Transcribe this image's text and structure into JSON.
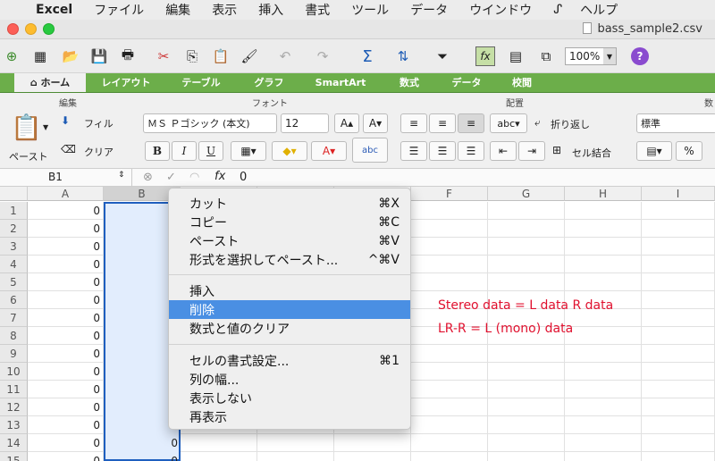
{
  "menubar": {
    "app_name": "Excel",
    "items": [
      "ファイル",
      "編集",
      "表示",
      "挿入",
      "書式",
      "ツール",
      "データ",
      "ウインドウ",
      "ヘルプ"
    ]
  },
  "window": {
    "title": "bass_sample2.csv",
    "zoom": "100%",
    "help": "?"
  },
  "tabs": [
    "ホーム",
    "レイアウト",
    "テーブル",
    "グラフ",
    "SmartArt",
    "数式",
    "データ",
    "校閲"
  ],
  "ribbon": {
    "groups": {
      "edit": "編集",
      "font": "フォント",
      "alignment": "配置",
      "number": "数"
    },
    "paste_label": "ペースト",
    "fill_label": "フィル",
    "clear_label": "クリア",
    "font_name": "ＭＳ Ｐゴシック (本文)",
    "font_size": "12",
    "bold": "B",
    "italic": "I",
    "underline": "U",
    "wrap_label": "折り返し",
    "merge_label": "セル結合",
    "number_format": "標準",
    "abc_label": "abc",
    "percent": "%"
  },
  "formula_bar": {
    "name_box": "B1",
    "fx": "fx",
    "value": "0"
  },
  "columns": [
    "A",
    "B",
    "C",
    "D",
    "E",
    "F",
    "G",
    "H",
    "I"
  ],
  "rows": [
    "1",
    "2",
    "3",
    "4",
    "5",
    "6",
    "7",
    "8",
    "9",
    "10",
    "11",
    "12",
    "13",
    "14",
    "15"
  ],
  "cells_A": [
    "0",
    "0",
    "0",
    "0",
    "0",
    "0",
    "0",
    "0",
    "0",
    "0",
    "0",
    "0",
    "0",
    "0",
    "0"
  ],
  "cells_B_visible": {
    "14": "0",
    "15": "0"
  },
  "notes": [
    "Stereo data = L data R data",
    "LR-R = L (mono) data"
  ],
  "context_menu": [
    {
      "label": "カット",
      "shortcut": "⌘X"
    },
    {
      "label": "コピー",
      "shortcut": "⌘C"
    },
    {
      "label": "ペースト",
      "shortcut": "⌘V"
    },
    {
      "label": "形式を選択してペースト...",
      "shortcut": "^⌘V"
    },
    {
      "label": "挿入",
      "shortcut": ""
    },
    {
      "label": "削除",
      "shortcut": ""
    },
    {
      "label": "数式と値のクリア",
      "shortcut": ""
    },
    {
      "label": "セルの書式設定...",
      "shortcut": "⌘1"
    },
    {
      "label": "列の幅...",
      "shortcut": ""
    },
    {
      "label": "表示しない",
      "shortcut": ""
    },
    {
      "label": "再表示",
      "shortcut": ""
    }
  ],
  "colors": {
    "tab_bar": "#6cae4a",
    "highlight": "#4a8fe3",
    "note_text": "#e0102e",
    "selection_border": "#1f5fbf"
  }
}
